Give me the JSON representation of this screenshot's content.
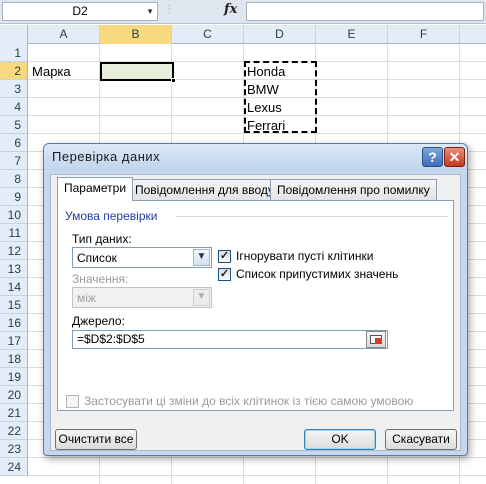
{
  "formula_bar": {
    "name_box": "D2",
    "name_box_arrow": "▼",
    "fx_dots": "⋮",
    "fx_label": "fx",
    "formula": ""
  },
  "sheet": {
    "columns": [
      "A",
      "B",
      "C",
      "D",
      "E",
      "F"
    ],
    "selected_column": "B",
    "rows": [
      "1",
      "2",
      "3",
      "4",
      "5",
      "6",
      "7",
      "8",
      "9",
      "10",
      "11",
      "12",
      "13",
      "14",
      "15",
      "16",
      "17",
      "18",
      "19",
      "20",
      "21",
      "22",
      "23",
      "24"
    ],
    "selected_row": "2",
    "cells": {
      "A2": "Марка",
      "D2": "Honda",
      "D3": "BMW",
      "D4": "Lexus",
      "D5": "Ferrari"
    }
  },
  "dialog": {
    "title": "Перевірка даних",
    "help_icon": "?",
    "close_icon": "✕",
    "tabs": [
      {
        "label": "Параметри",
        "active": true
      },
      {
        "label": "Повідомлення для вводу",
        "active": false
      },
      {
        "label": "Повідомлення про помилку",
        "active": false
      }
    ],
    "group_title": "Умова перевірки",
    "data_type_label": "Тип даних:",
    "data_type_value": "Список",
    "value_label": "Значення:",
    "value_value": "між",
    "ignore_blank_label": "Ігнорувати пусті клітинки",
    "ignore_blank_checked": true,
    "incell_dropdown_label": "Список припустимих значень",
    "incell_dropdown_checked": true,
    "source_label": "Джерело:",
    "source_value": "=$D$2:$D$5",
    "apply_all_label": "Застосувати ці зміни до всіх клітинок із тією самою умовою",
    "apply_all_checked": false,
    "check_mark": "✓",
    "dropdown_arrow": "▼",
    "clear_all_label": "Очистити все",
    "ok_label": "OK",
    "cancel_label": "Скасувати"
  }
}
